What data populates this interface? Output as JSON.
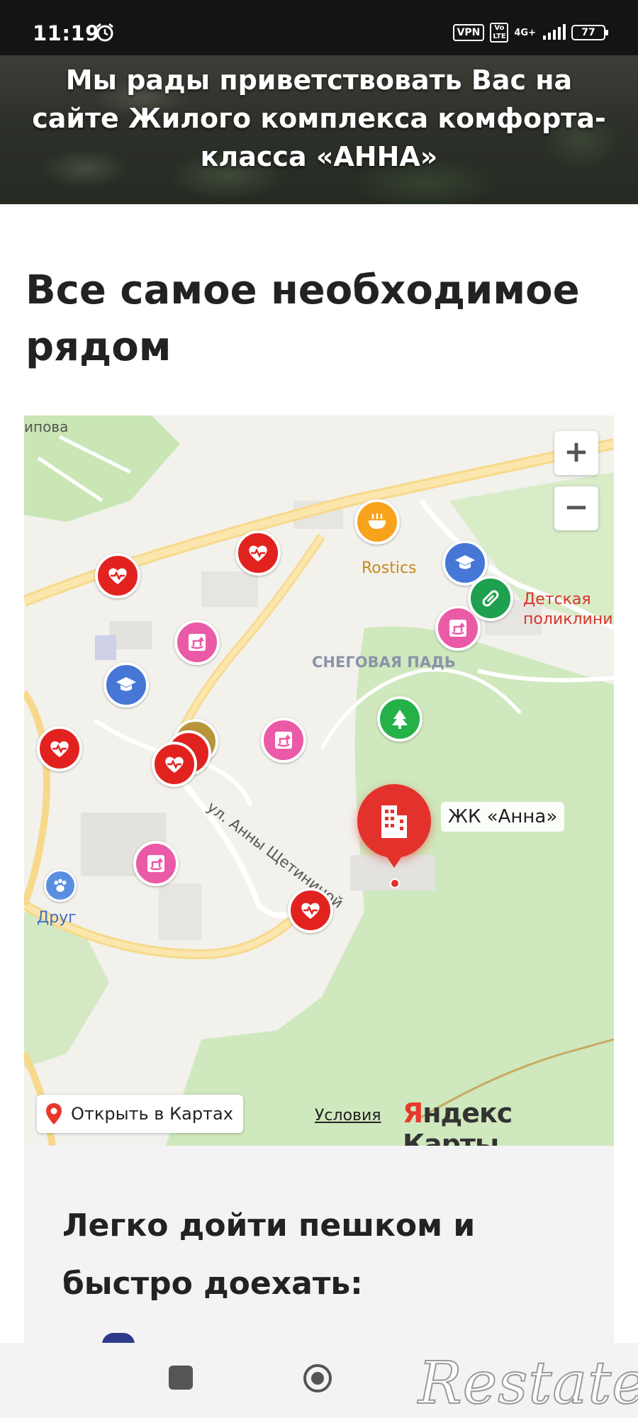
{
  "status_bar": {
    "time": "11:19",
    "vpn": "VPN",
    "volte": "Vo LTE",
    "network": "4G+",
    "battery": "77"
  },
  "hero": {
    "title": "Мы рады приветствовать Вас на сайте Жилого комплекса комфорта-класса «АННА»"
  },
  "nearby": {
    "title": "Все самое необходимое рядом"
  },
  "map": {
    "labels": {
      "street_top": "ипова",
      "rostics": "Rostics",
      "clinic": "Детская поликлиника",
      "district": "СНЕГОВАЯ ПАДЬ",
      "street": "ул. Анны Щетининой",
      "drug": "Друг"
    },
    "zoom_in": "+",
    "zoom_out": "−",
    "anna_label": "ЖК «Анна»",
    "open_in_maps": "Открыть в Картах",
    "terms": "Условия",
    "logo_ya": "Я",
    "logo_rest": "ндекс Карты",
    "colors": {
      "health": "#e2221f",
      "kids": "#ea5aa7",
      "education": "#4677d6",
      "food": "#f7a31b",
      "pharmacy": "#1ea04e",
      "park": "#24b148",
      "main_pin": "#e3322b"
    }
  },
  "walk": {
    "title": "Легко дойти пешком и быстро доехать:"
  },
  "nav_bar": {
    "watermark": "Restate"
  }
}
